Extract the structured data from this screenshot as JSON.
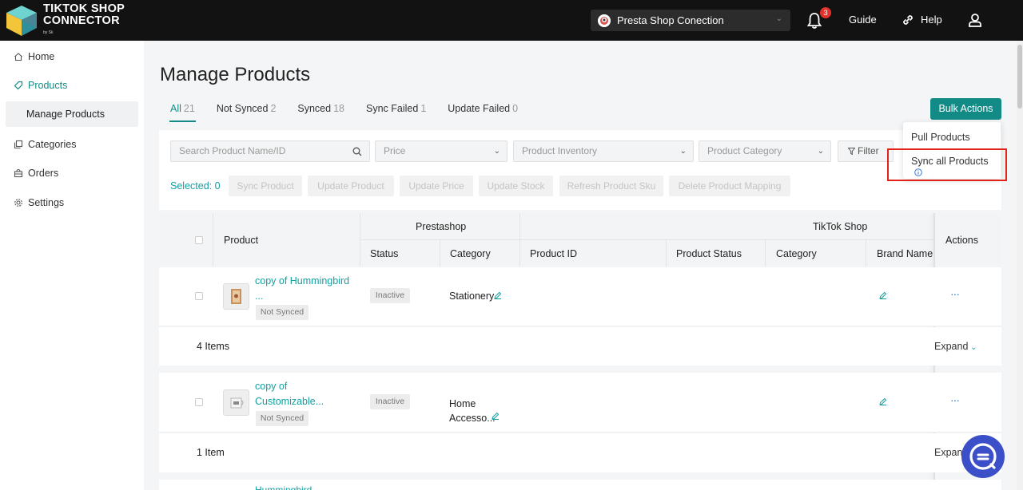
{
  "app": {
    "logo_line1": "TIKTOK SHOP",
    "logo_line2": "CONNECTOR",
    "logo_by": "by Sk"
  },
  "header": {
    "store": "Presta Shop Conection",
    "notification_count": "3",
    "guide": "Guide",
    "help": "Help"
  },
  "sidebar": {
    "items": [
      {
        "label": "Home",
        "icon": "home-icon"
      },
      {
        "label": "Products",
        "icon": "tag-icon"
      },
      {
        "label": "Manage Products",
        "icon": ""
      },
      {
        "label": "Categories",
        "icon": "copy-icon"
      },
      {
        "label": "Orders",
        "icon": "bag-icon"
      },
      {
        "label": "Settings",
        "icon": "gear-icon"
      }
    ]
  },
  "page": {
    "title": "Manage Products"
  },
  "tabs": [
    {
      "label": "All",
      "count": "21"
    },
    {
      "label": "Not Synced",
      "count": "2"
    },
    {
      "label": "Synced",
      "count": "18"
    },
    {
      "label": "Sync Failed",
      "count": "1"
    },
    {
      "label": "Update Failed",
      "count": "0"
    }
  ],
  "bulk": {
    "label": "Bulk Actions",
    "menu": [
      "Pull Products",
      "Sync all Products"
    ]
  },
  "filters": {
    "search_placeholder": "Search Product Name/ID",
    "price": "Price",
    "inventory": "Product Inventory",
    "category": "Product Category",
    "filter": "Filter"
  },
  "actions": {
    "selected": "Selected: 0",
    "buttons": [
      "Sync Product",
      "Update Product",
      "Update Price",
      "Update Stock",
      "Refresh Product Sku",
      "Delete Product Mapping"
    ]
  },
  "table": {
    "product": "Product",
    "prestashop": "Prestashop",
    "tiktok": "TikTok Shop",
    "actions": "Actions",
    "status": "Status",
    "category": "Category",
    "product_id": "Product ID",
    "product_status": "Product Status",
    "tt_category": "Category",
    "brand": "Brand Name"
  },
  "rows": [
    {
      "name_l1": "copy of Hummingbird",
      "name_l2": "...",
      "sync": "Not Synced",
      "status": "Inactive",
      "category_l1": "Stationery",
      "category_l2": "",
      "items": "4 Items",
      "expand": "Expand"
    },
    {
      "name_l1": "copy of",
      "name_l2": "Customizable...",
      "sync": "Not Synced",
      "status": "Inactive",
      "category_l1": "Home",
      "category_l2": "Accesso...",
      "items": "1 Item",
      "expand": "Expand"
    }
  ],
  "row3_partial": "Hummingbird",
  "colors": {
    "accent": "#128b87",
    "link": "#14a0a0",
    "highlight": "#e2231a",
    "topbar": "#121212"
  }
}
